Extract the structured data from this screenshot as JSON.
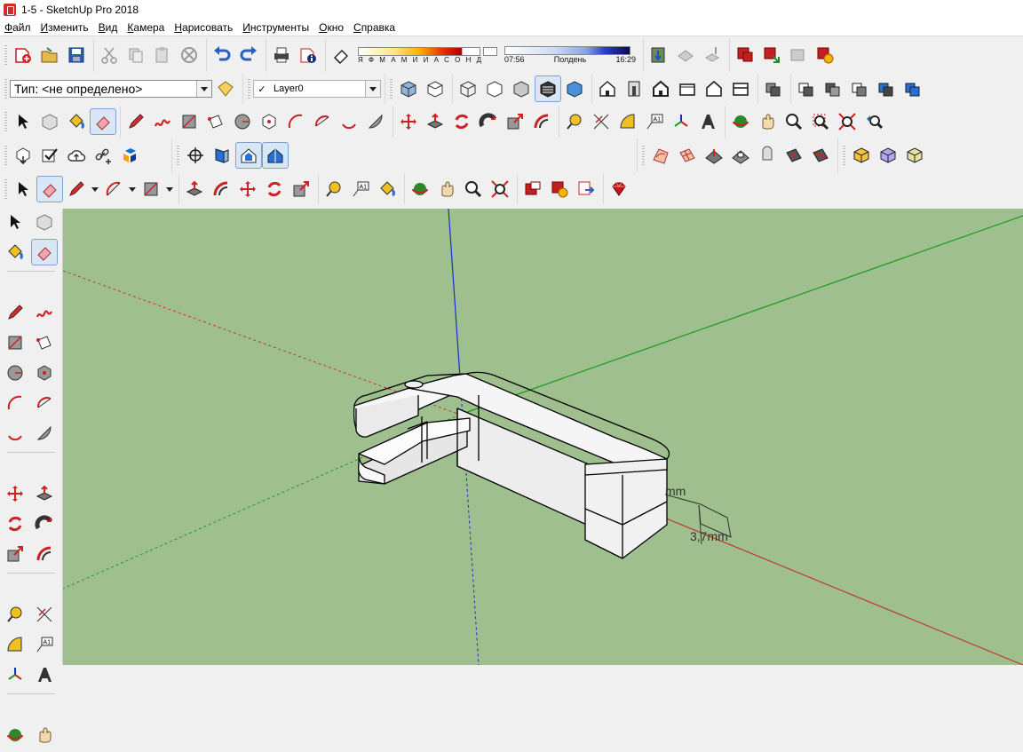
{
  "window": {
    "title": "1-5 - SketchUp Pro 2018"
  },
  "menu": [
    "Файл",
    "Изменить",
    "Вид",
    "Камера",
    "Нарисовать",
    "Инструменты",
    "Окно",
    "Справка"
  ],
  "toolbar": {
    "style_type": "Тип: <не определено>",
    "layer": "Layer0",
    "shadow_months": "Я Ф М А М И И А С О Н Д",
    "time_start": "07:56",
    "time_mid": "Полдень",
    "time_end": "16:29"
  },
  "viewport": {
    "dimension_labels": [
      "mm",
      "3,7mm"
    ],
    "colors": {
      "background": "#9fc08e",
      "axis_red": "#c0392b",
      "axis_green": "#1e9a1e",
      "axis_blue": "#1a2bd0"
    }
  },
  "icons": {
    "row1": [
      "new-icon",
      "open-icon",
      "save-icon",
      "cut-icon",
      "copy-icon",
      "paste-icon",
      "erase-icon",
      "undo-icon",
      "redo-icon",
      "print-icon",
      "model-info-icon"
    ],
    "row1b": [
      "geo-location-icon",
      "3d-warehouse-share-icon",
      "3d-warehouse-get-icon",
      "extension-warehouse-icon",
      "layout-send-icon",
      "preferences-icon",
      "extensions-icon"
    ],
    "row2_views": [
      "iso-view-icon",
      "top-view-icon",
      "front-view-icon",
      "right-view-icon",
      "back-view-icon",
      "left-view-icon"
    ],
    "row2_styles": [
      "xray-icon",
      "back-edges-icon",
      "wireframe-icon",
      "hidden-line-icon",
      "shaded-icon",
      "shaded-textures-icon",
      "monochrome-icon"
    ],
    "row2_house": [
      "house-iso-icon",
      "house-door-icon",
      "house-front-icon",
      "house-top-icon",
      "house-outline-icon",
      "house-section-icon"
    ],
    "row2_sections": [
      "section-plane-icon",
      "section-cut-icon",
      "section-fill-icon",
      "display-section-icon",
      "section-cuts-icon",
      "section-planes-icon"
    ]
  }
}
